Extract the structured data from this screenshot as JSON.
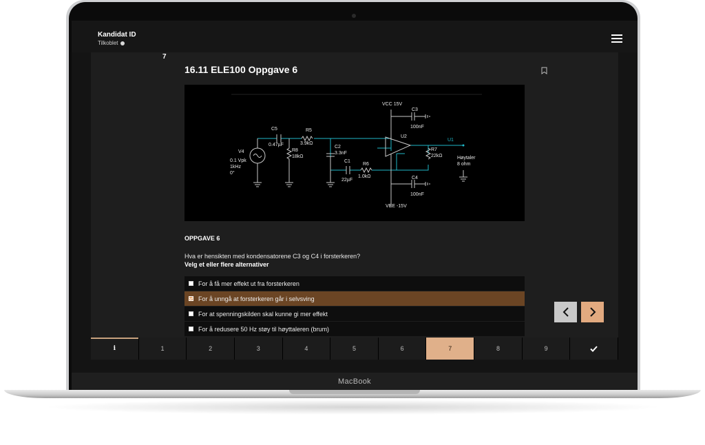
{
  "device": {
    "label": "MacBook"
  },
  "header": {
    "candidate_title": "Kandidat ID",
    "connection_status": "Tilkoblet",
    "menu_icon": "hamburger-menu-icon"
  },
  "question": {
    "number": "7",
    "title": "16.11 ELE100 Oppgave 6",
    "bookmark_icon": "bookmark-icon",
    "section_heading": "OPPGAVE 6",
    "text": "Hva er hensikten med kondensatorene C3 og C4 i forsterkeren?",
    "instruction": "Velg et eller flere alternativer"
  },
  "circuit": {
    "vcc": "VCC  15V",
    "vee": "VEE  -15V",
    "c3_name": "C3",
    "c3_value": "100nF",
    "c4_name": "C4",
    "c4_value": "100nF",
    "c5_name": "C5",
    "c5_value": "0.47µF",
    "r5_name": "R5",
    "r5_value": "3.9kΩ",
    "r8_name": "R8",
    "r8_value": "18kΩ",
    "c2_name": "C2",
    "c2_value": "3.3nF",
    "c1_name": "C1",
    "c1_value": "22µF",
    "r6_name": "R6",
    "r6_value": "1.0kΩ",
    "r7_name": "R7",
    "r7_value": "22kΩ",
    "u2_name": "U2",
    "out_label": "U1",
    "speaker_label_1": "Høytaler",
    "speaker_label_2": "8 ohm",
    "v4_name": "V4",
    "v4_line1": "0.1 Vpk",
    "v4_line2": "1kHz",
    "v4_line3": "0°"
  },
  "options": [
    {
      "label": "For å få mer effekt ut fra forsterkeren",
      "checked": false
    },
    {
      "label": "For å unngå at forsterkeren går i selvsving",
      "checked": true
    },
    {
      "label": "For at spenningskilden skal kunne gi mer effekt",
      "checked": false
    },
    {
      "label": "For å redusere 50 Hz støy til høyttaleren (brum)",
      "checked": false
    }
  ],
  "navigation": {
    "prev_icon": "chevron-left-icon",
    "next_icon": "chevron-right-icon",
    "tabs": [
      "i",
      "1",
      "2",
      "3",
      "4",
      "5",
      "6",
      "7",
      "8",
      "9"
    ],
    "active_tab": "7",
    "finish_icon": "checkmark-icon"
  },
  "colors": {
    "selected_option": "#6b4524",
    "active_tab": "#e0b08a",
    "next_button": "#e2aa80",
    "wire": "#1fb8c9"
  }
}
